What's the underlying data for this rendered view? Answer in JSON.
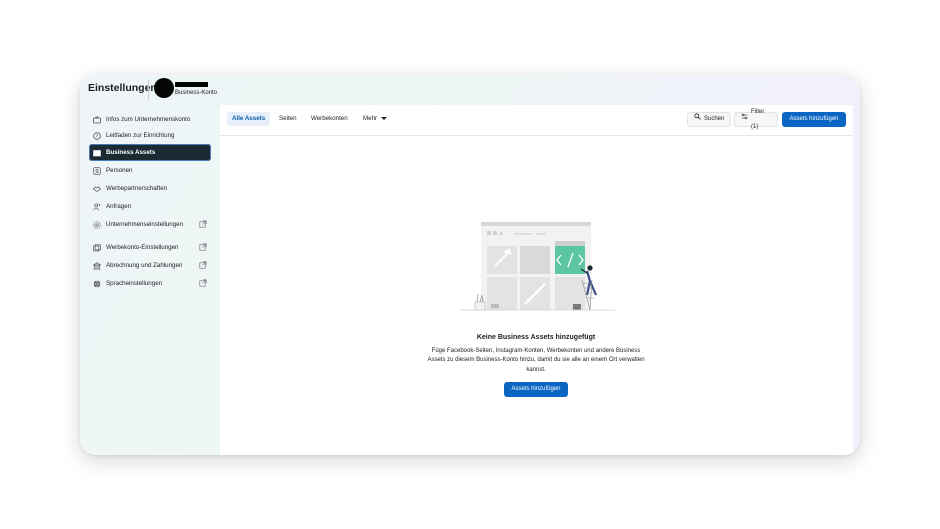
{
  "header": {
    "title": "Einstellungen",
    "account_type": "Business-Konto"
  },
  "sidebar": {
    "items": [
      {
        "label": "Infos zum Unternehmenskonto",
        "icon": "briefcase-icon"
      },
      {
        "label": "Leitfaden zur Einrichtung",
        "icon": "help-circle-icon"
      },
      {
        "label": "Business Assets",
        "icon": "folder-icon",
        "active": true
      },
      {
        "label": "Personen",
        "icon": "people-icon"
      },
      {
        "label": "Werbepartnerschaften",
        "icon": "handshake-icon"
      },
      {
        "label": "Anfragen",
        "icon": "person-add-icon"
      },
      {
        "label": "Unternehmenseinstellungen",
        "icon": "gear-icon",
        "external": true
      },
      {
        "label": "Werbekonto-Einstellungen",
        "icon": "ad-account-icon",
        "external": true
      },
      {
        "label": "Abrechnung und Zahlungen",
        "icon": "bank-icon",
        "external": true
      },
      {
        "label": "Spracheinstellungen",
        "icon": "globe-icon",
        "external": true
      }
    ]
  },
  "tabs": [
    {
      "label": "Alle Assets",
      "active": true
    },
    {
      "label": "Seiten"
    },
    {
      "label": "Werbekonten"
    },
    {
      "label": "Mehr"
    }
  ],
  "toolbar": {
    "search_label": "Suchen",
    "filter_label": "Filter (1)",
    "add_assets_label": "Assets hinzufügen"
  },
  "empty_state": {
    "title": "Keine Business Assets hinzugefügt",
    "description": "Füge Facebook-Seiten, Instagram-Konten, Werbekonten und andere Business Assets zu diesem Business-Konto hinzu, damit du sie alle an einem Ort verwalten kannst.",
    "button_label": "Assets hinzufügen"
  },
  "colors": {
    "primary": "#0a66c2",
    "active_nav": "#1c2b33",
    "active_tab_bg": "#e7f0fa",
    "accent_green": "#5cc6a3"
  }
}
